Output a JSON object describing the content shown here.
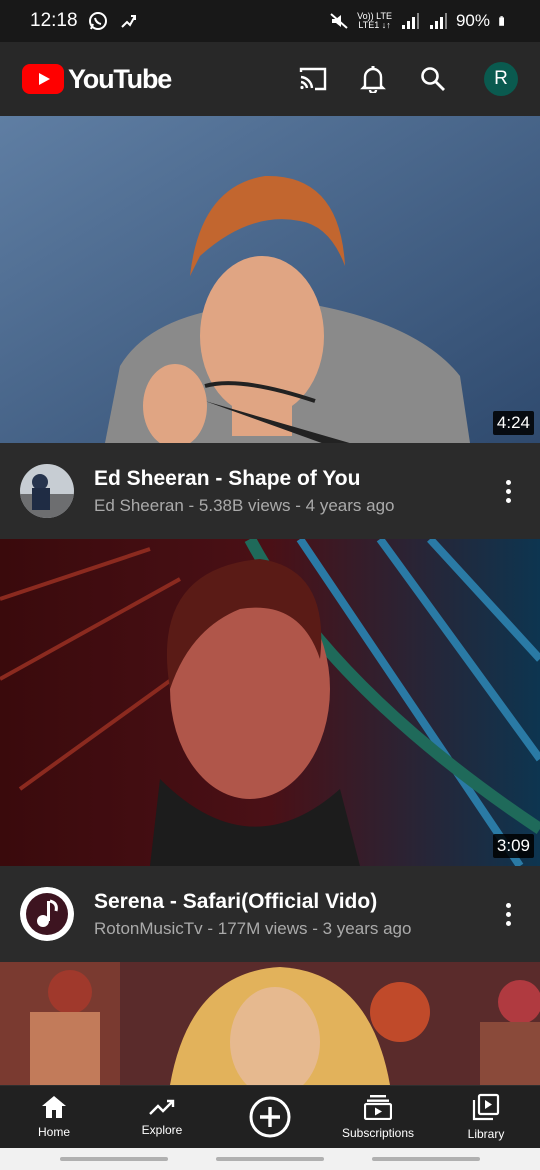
{
  "status": {
    "time": "12:18",
    "battery": "90%",
    "volte_line1": "Vo)) LTE",
    "volte_line2": "LTE1 ↓↑"
  },
  "app_bar": {
    "logo_text": "YouTube",
    "avatar_initial": "R",
    "icons": [
      "cast-icon",
      "notifications-bell-icon",
      "search-icon"
    ],
    "brand_color": "#ff0000"
  },
  "videos": [
    {
      "title": "Ed Sheeran - Shape of You",
      "subtitle": "Ed Sheeran - 5.38B views - 4 years ago",
      "duration": "4:24"
    },
    {
      "title": "Serena - Safari(Official Vido)",
      "subtitle": "RotonMusicTv - 177M views - 3 years ago",
      "duration": "3:09"
    }
  ],
  "bottom_nav": {
    "home": "Home",
    "explore": "Explore",
    "subscriptions": "Subscriptions",
    "library": "Library"
  }
}
